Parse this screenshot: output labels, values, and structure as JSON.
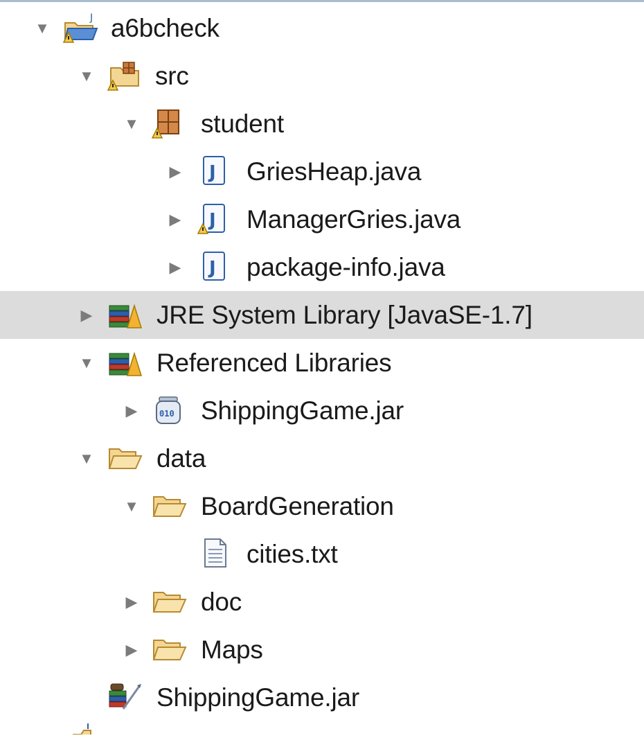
{
  "explorer": {
    "project": {
      "label": "a6bcheck",
      "icon": "java-project-warning-icon",
      "expanded": true
    },
    "src": {
      "label": "src",
      "icon": "source-folder-warning-icon",
      "expanded": true
    },
    "student": {
      "label": "student",
      "icon": "package-warning-icon",
      "expanded": true
    },
    "files": [
      {
        "label": "GriesHeap.java",
        "icon": "java-file-icon",
        "expanded": false
      },
      {
        "label": "ManagerGries.java",
        "icon": "java-file-warning-icon",
        "expanded": false
      },
      {
        "label": "package-info.java",
        "icon": "java-file-icon",
        "expanded": false
      }
    ],
    "jre": {
      "label": "JRE System Library [JavaSE-1.7]",
      "icon": "library-icon",
      "expanded": false,
      "selected": true
    },
    "referenced": {
      "label": "Referenced Libraries",
      "icon": "library-icon",
      "expanded": true
    },
    "ref_jar": {
      "label": "ShippingGame.jar",
      "icon": "jar-binary-icon",
      "expanded": false
    },
    "data_folder": {
      "label": "data",
      "icon": "folder-icon",
      "expanded": true
    },
    "board": {
      "label": "BoardGeneration",
      "icon": "folder-icon",
      "expanded": true
    },
    "cities": {
      "label": "cities.txt",
      "icon": "text-file-icon"
    },
    "doc": {
      "label": "doc",
      "icon": "folder-icon",
      "expanded": false
    },
    "maps": {
      "label": "Maps",
      "icon": "folder-icon",
      "expanded": false
    },
    "root_jar": {
      "label": "ShippingGame.jar",
      "icon": "jar-archive-icon"
    }
  },
  "colors": {
    "selection": "#dcdcdc",
    "folder_fill": "#f3d694",
    "folder_stroke": "#b88a2e",
    "java_blue": "#2e5fa8",
    "warning": "#f2c94c",
    "twisty": "#7b7b7b"
  },
  "glyphs": {
    "expanded": "▼",
    "collapsed": "▶",
    "java_letter": "J",
    "jar_bits": "010"
  }
}
